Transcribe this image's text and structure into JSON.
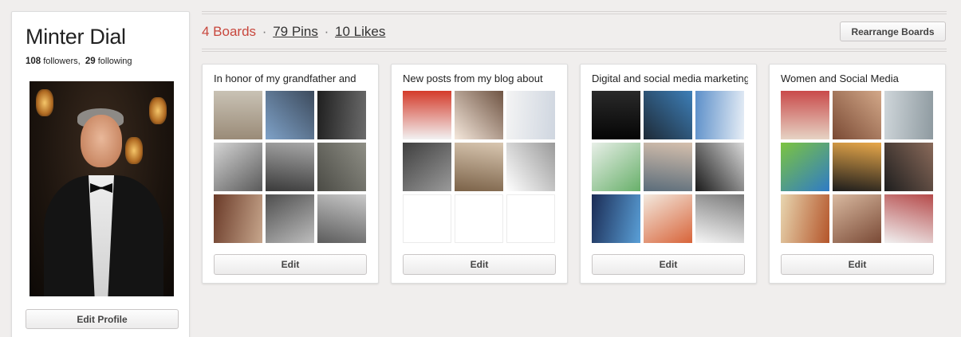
{
  "profile": {
    "name": "Minter Dial",
    "followers_count": "108",
    "followers_label": "followers,",
    "following_count": "29",
    "following_label": "following",
    "edit_profile_label": "Edit Profile"
  },
  "header": {
    "boards": "4 Boards",
    "pins": "79 Pins",
    "likes": "10 Likes",
    "separator": "·",
    "rearrange_label": "Rearrange Boards"
  },
  "boards": [
    {
      "title": "In honor of my grandfather and",
      "edit_label": "Edit",
      "thumbs": [
        {
          "c1": "#9a8b78",
          "c2": "#c9c2b5"
        },
        {
          "c1": "#7fa2c8",
          "c2": "#3c4a5c"
        },
        {
          "c1": "#1f1f1f",
          "c2": "#6b6b6b"
        },
        {
          "c1": "#d5d5d5",
          "c2": "#5a5a5a"
        },
        {
          "c1": "#3a3a3a",
          "c2": "#a8a8a8"
        },
        {
          "c1": "#4b4b45",
          "c2": "#8f8f86"
        },
        {
          "c1": "#6a3a28",
          "c2": "#c7a68c"
        },
        {
          "c1": "#4e4e4e",
          "c2": "#bdbdbd"
        },
        {
          "c1": "#5c5c5c",
          "c2": "#c9c9c9"
        }
      ]
    },
    {
      "title": "New posts from my blog about",
      "edit_label": "Edit",
      "thumbs": [
        {
          "c1": "#f2f2f2",
          "c2": "#d43b2a"
        },
        {
          "c1": "#f5e8dc",
          "c2": "#6f5443"
        },
        {
          "c1": "#f4f4f4",
          "c2": "#cfd6e0"
        },
        {
          "c1": "#3f3f3f",
          "c2": "#9a9a9a"
        },
        {
          "c1": "#7b6248",
          "c2": "#d9c7b1"
        },
        {
          "c1": "#ffffff",
          "c2": "#9a9a9a"
        },
        {
          "empty": true
        },
        {
          "empty": true
        },
        {
          "empty": true
        }
      ]
    },
    {
      "title": "Digital and social media marketing",
      "edit_label": "Edit",
      "thumbs": [
        {
          "c1": "#050505",
          "c2": "#2a2a2a"
        },
        {
          "c1": "#1e2a36",
          "c2": "#3d7fb8"
        },
        {
          "c1": "#5c8fc9",
          "c2": "#e7eef6"
        },
        {
          "c1": "#e8efe8",
          "c2": "#68b06a"
        },
        {
          "c1": "#5a6c7a",
          "c2": "#d6c0ad"
        },
        {
          "c1": "#1a1a1a",
          "c2": "#d9d9d9"
        },
        {
          "c1": "#1b2c55",
          "c2": "#5aa0d8"
        },
        {
          "c1": "#f3e9de",
          "c2": "#d8643a"
        },
        {
          "c1": "#f6f6f6",
          "c2": "#7a7a7a"
        }
      ]
    },
    {
      "title": "Women and Social Media",
      "edit_label": "Edit",
      "thumbs": [
        {
          "c1": "#e6d3c4",
          "c2": "#c94a4a"
        },
        {
          "c1": "#7a4a34",
          "c2": "#d3a889"
        },
        {
          "c1": "#cfd6da",
          "c2": "#8e9aa0"
        },
        {
          "c1": "#7cc440",
          "c2": "#2f7bc6"
        },
        {
          "c1": "#1c1c1c",
          "c2": "#e8a84a"
        },
        {
          "c1": "#1e1e1e",
          "c2": "#8a6a5a"
        },
        {
          "c1": "#e8d6b0",
          "c2": "#b4552a"
        },
        {
          "c1": "#d9b9a0",
          "c2": "#7a4a36"
        },
        {
          "c1": "#f1f1f1",
          "c2": "#b54a4a"
        }
      ]
    }
  ]
}
